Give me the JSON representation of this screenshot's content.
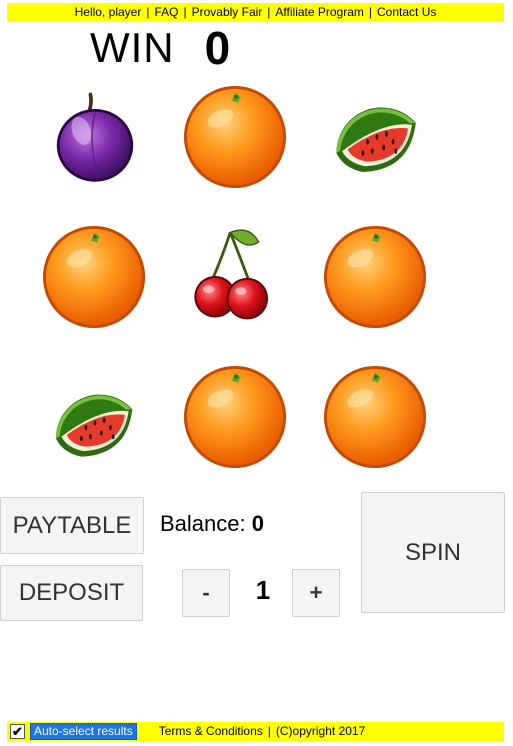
{
  "header": {
    "greeting": "Hello, player",
    "links": [
      "FAQ",
      "Provably Fair",
      "Affiliate Program",
      "Contact Us"
    ],
    "background_color": "#ffff00"
  },
  "win": {
    "label": "WIN",
    "value": "0"
  },
  "reels": {
    "grid": [
      [
        "plum",
        "orange",
        "watermelon"
      ],
      [
        "orange",
        "cherry",
        "orange"
      ],
      [
        "watermelon",
        "orange",
        "orange"
      ]
    ]
  },
  "controls": {
    "paytable_label": "PAYTABLE",
    "deposit_label": "DEPOSIT",
    "spin_label": "SPIN",
    "balance_label": "Balance:",
    "balance_value": "0",
    "minus_label": "-",
    "plus_label": "+",
    "bet_value": "1"
  },
  "footer": {
    "auto_select_label": "Auto-select results",
    "auto_select_checked": true,
    "checkbox_glyph": "✔",
    "terms_label": "Terms & Conditions",
    "copyright": "(C)opyright 2017",
    "background_color": "#ffff00"
  }
}
